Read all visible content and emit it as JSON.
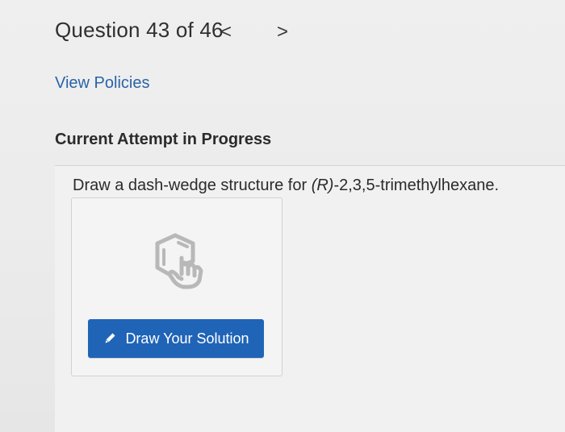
{
  "header": {
    "question_label": "Question 43 of 46",
    "prev_symbol": "<",
    "next_symbol": ">"
  },
  "links": {
    "view_policies": "View Policies"
  },
  "status": {
    "attempt_label": "Current Attempt in Progress"
  },
  "question": {
    "prefix": "Draw a dash-wedge structure for ",
    "stereo": "(R)",
    "suffix": "-2,3,5-trimethylhexane."
  },
  "drawing": {
    "icon": "molecule-drawing-icon",
    "button_icon": "pencil-icon",
    "button_label": "Draw Your Solution"
  },
  "colors": {
    "accent": "#1f64b7",
    "link": "#2a63a8",
    "background": "#ececec"
  }
}
